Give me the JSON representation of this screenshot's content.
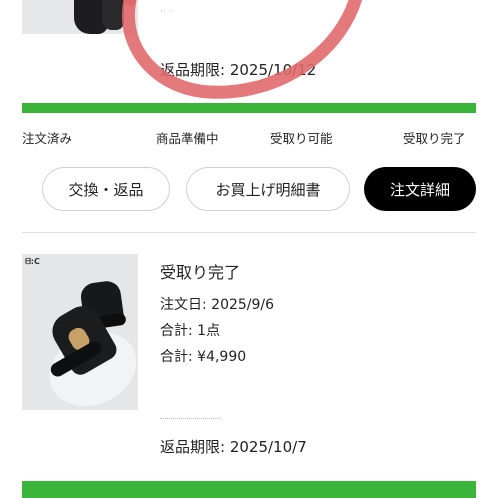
{
  "previous_order": {
    "return_deadline": "返品期限: 2025/10/12"
  },
  "status_steps": [
    "注文済み",
    "商品準備中",
    "受取り可能",
    "受取り完了"
  ],
  "actions": {
    "exchange_return": "交換・返品",
    "receipt": "お買上げ明細書",
    "order_detail": "注文詳細"
  },
  "order": {
    "brand_mark": "ᗺ:C",
    "status": "受取り完了",
    "order_date": "注文日: 2025/9/6",
    "quantity": "合計: 1点",
    "total": "合計: ¥4,990",
    "return_deadline": "返品期限: 2025/10/7"
  },
  "colors": {
    "progress": "#3ab53a",
    "annotation": "#e0676a",
    "primary_button": "#000000"
  },
  "icons": {
    "annotation": "red-hand-drawn-circle"
  }
}
